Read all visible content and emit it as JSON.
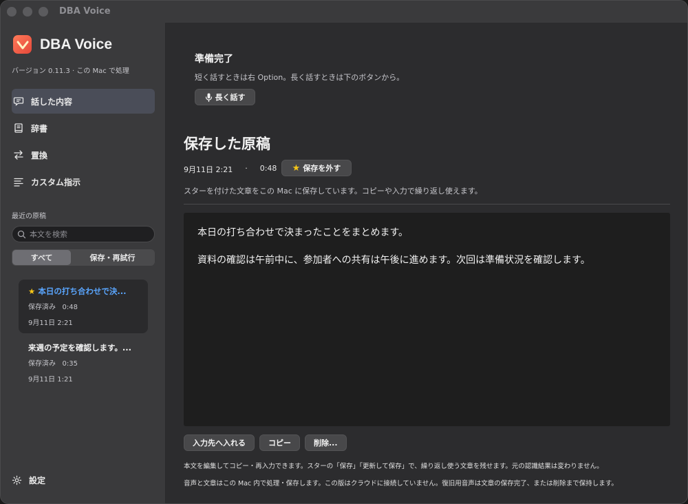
{
  "window": {
    "title": "DBA Voice"
  },
  "sidebar": {
    "app_name": "DBA Voice",
    "version": "バージョン 0.11.3 · この Mac で処理",
    "nav": [
      {
        "label": "話した内容",
        "icon": "speech-bubble-icon",
        "active": true
      },
      {
        "label": "辞書",
        "icon": "book-icon",
        "active": false
      },
      {
        "label": "置換",
        "icon": "swap-arrows-icon",
        "active": false
      },
      {
        "label": "カスタム指示",
        "icon": "lines-icon",
        "active": false
      }
    ],
    "recent_label": "最近の原稿",
    "search": {
      "placeholder": "本文を検索",
      "value": ""
    },
    "filter": {
      "all": "すべて",
      "saved_retry": "保存・再試行",
      "selected": "すべて"
    },
    "drafts": [
      {
        "title": "本日の打ち合わせで決...",
        "starred": true,
        "status": "保存済み",
        "duration": "0:48",
        "date": "9月11日 2:21",
        "active": true
      },
      {
        "title": "来週の予定を確認します。...",
        "starred": false,
        "status": "保存済み",
        "duration": "0:35",
        "date": "9月11日 1:21",
        "active": false
      }
    ],
    "settings_label": "設定"
  },
  "main": {
    "status_title": "準備完了",
    "status_desc": "短く話すときは右 Option。長く話すときは下のボタンから。",
    "talk_button": "長く話す",
    "heading": "保存した原稿",
    "date": "9月11日 2:21",
    "separator": "·",
    "duration": "0:48",
    "unstar_button": "保存を外す",
    "saved_desc": "スターを付けた文章をこの Mac に保存しています。コピーや入力で繰り返し使えます。",
    "body": [
      "本日の打ち合わせで決まったことをまとめます。",
      "資料の確認は午前中に、参加者への共有は午後に進めます。次回は準備状況を確認します。"
    ],
    "actions": {
      "insert": "入力先へ入れる",
      "copy": "コピー",
      "delete": "削除..."
    },
    "note1": "本文を編集してコピー・再入力できます。スターの「保存」「更新して保存」で、繰り返し使う文章を残せます。元の認識結果は変わりません。",
    "note2": "音声と文章はこの Mac 内で処理・保存します。この版はクラウドに接続していません。復旧用音声は文章の保存完了、または削除まで保持します。"
  },
  "colors": {
    "accent": "#5aa6ff",
    "star": "#f5c518",
    "active_nav": "#4a4d58"
  }
}
